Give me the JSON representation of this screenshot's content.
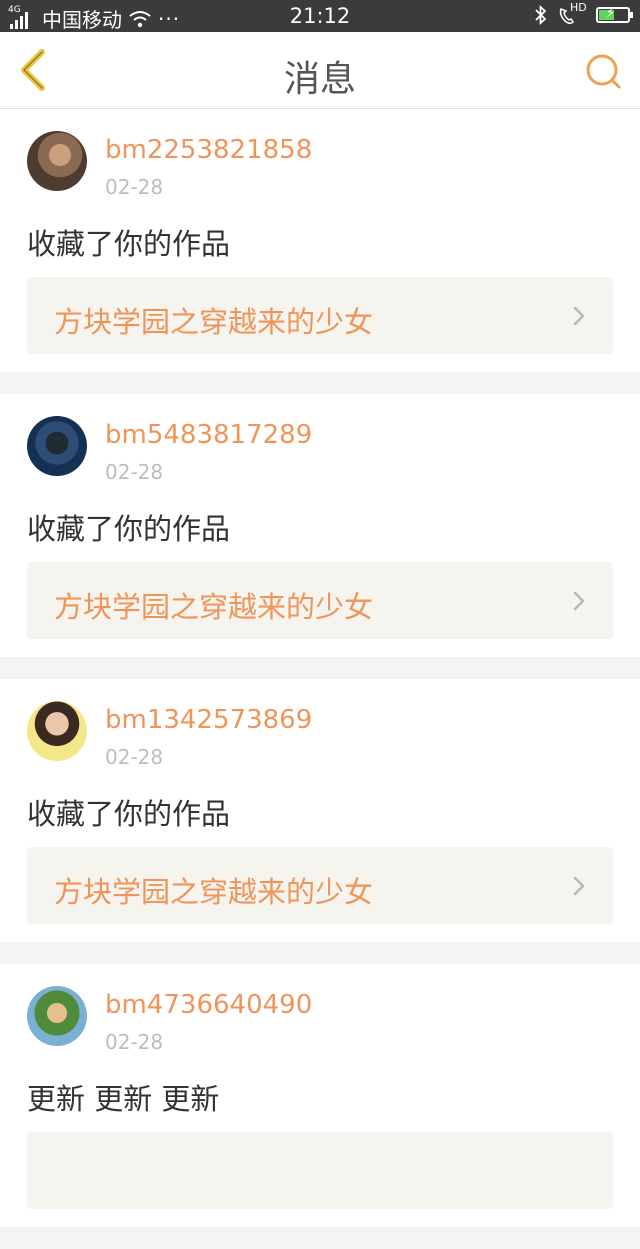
{
  "status_bar": {
    "network": "4G",
    "carrier": "中国移动",
    "time": "21:12",
    "hd_label": "HD",
    "battery_level": 0.55
  },
  "header": {
    "title": "消息",
    "back_icon": "chevron-left-icon",
    "search_icon": "search-icon",
    "accent_color": "#f0a050",
    "back_color": "#e8c23a"
  },
  "messages": [
    {
      "username": "bm2253821858",
      "date": "02-28",
      "action": "收藏了你的作品",
      "work_title": "方块学园之穿越来的少女"
    },
    {
      "username": "bm5483817289",
      "date": "02-28",
      "action": "收藏了你的作品",
      "work_title": "方块学园之穿越来的少女"
    },
    {
      "username": "bm1342573869",
      "date": "02-28",
      "action": "收藏了你的作品",
      "work_title": "方块学园之穿越来的少女"
    },
    {
      "username": "bm4736640490",
      "date": "02-28",
      "action": "更新 更新 更新",
      "work_title": ""
    }
  ]
}
